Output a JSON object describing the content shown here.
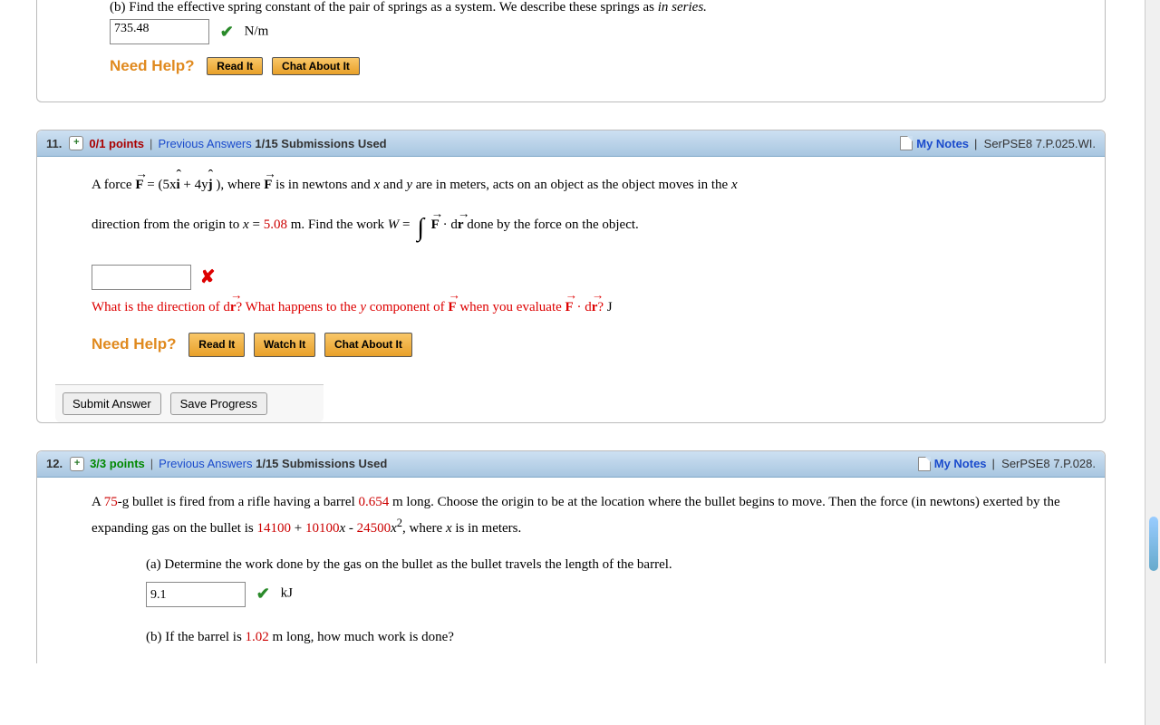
{
  "q10": {
    "part_b_prompt": "(b) Find the effective spring constant of the pair of springs as a system. We describe these springs as",
    "part_b_suffix": "in series.",
    "answer": "735.48",
    "unit": "N/m",
    "need_help": "Need Help?",
    "read_it": "Read It",
    "chat": "Chat About It"
  },
  "q11": {
    "num": "11.",
    "points": "0/1 points",
    "prev": "Previous Answers",
    "subs": "1/15 Submissions Used",
    "my_notes": "My Notes",
    "ref": "SerPSE8 7.P.025.WI.",
    "line1a": "A force ",
    "force_eq": " = (5x",
    "force_eq_b": "+ 4y",
    "line1b": "), where ",
    "line1c": " is in newtons and ",
    "line1d": " and ",
    "line1e": " are in meters, acts on an object as the object moves in the ",
    "line2a": "direction from the origin to ",
    "xval": "5.08",
    "line2b": " m. Find the work  ",
    "line2c": " done by the force on the object.",
    "hint": "What is the direction of d",
    "hint2": "? What happens to the ",
    "hint3": " component of ",
    "hint4": " when you evaluate ",
    "hint5": "?",
    "unit": "J",
    "need_help": "Need Help?",
    "read_it": "Read It",
    "watch_it": "Watch It",
    "chat": "Chat About It",
    "submit": "Submit Answer",
    "save": "Save Progress"
  },
  "q12": {
    "num": "12.",
    "points": "3/3 points",
    "prev": "Previous Answers",
    "subs": "1/15 Submissions Used",
    "my_notes": "My Notes",
    "ref": "SerPSE8 7.P.028.",
    "line1a": "A ",
    "mass": "75",
    "line1b": "-g bullet is fired from a rifle having a barrel ",
    "len": "0.654",
    "line1c": " m long. Choose the origin to be at the location where the bullet begins to move. Then the force (in newtons) exerted by the expanding gas on the bullet is ",
    "c1": "14100",
    "plus": " + ",
    "c2": "10100",
    "x": "x",
    "minus": " - ",
    "c3": "24500",
    "xsq": "x",
    "line1d": ", where ",
    "line1e": " is in meters.",
    "part_a": "(a) Determine the work done by the gas on the bullet as the bullet travels the length of the barrel.",
    "ans_a": "9.1",
    "unit_a": "kJ",
    "part_b_a": "(b) If the barrel is ",
    "len_b": "1.02",
    "part_b_b": " m long, how much work is done?"
  }
}
